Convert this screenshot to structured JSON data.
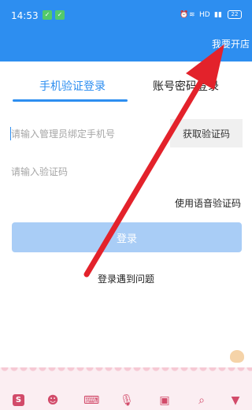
{
  "status_bar": {
    "time": "14:53",
    "network": "HD",
    "battery": "22"
  },
  "header": {
    "open_store_label": "我要开店"
  },
  "tabs": [
    {
      "label": "手机验证登录",
      "active": true
    },
    {
      "label": "账号密码登录",
      "active": false
    }
  ],
  "form": {
    "phone_placeholder": "请输入管理员绑定手机号",
    "get_code_label": "获取验证码",
    "code_placeholder": "请输入验证码",
    "voice_code_label": "使用语音验证码",
    "login_button_label": "登录",
    "problem_link_label": "登录遇到问题"
  },
  "ime_keys": [
    {
      "name": "sogou-logo-icon",
      "glyph": "S"
    },
    {
      "name": "emoji-icon",
      "glyph": "☻"
    },
    {
      "name": "keyboard-icon",
      "glyph": "⌨"
    },
    {
      "name": "microphone-icon",
      "glyph": "🎙"
    },
    {
      "name": "toolbox-icon",
      "glyph": "▣"
    },
    {
      "name": "ime-search-icon",
      "glyph": "⌕"
    },
    {
      "name": "collapse-keyboard-icon",
      "glyph": "▼"
    }
  ],
  "colors": {
    "primary": "#2d8ef0",
    "button_disabled": "#a9cdf6",
    "arrow": "#e3222b",
    "ime_accent": "#d24b6a"
  }
}
